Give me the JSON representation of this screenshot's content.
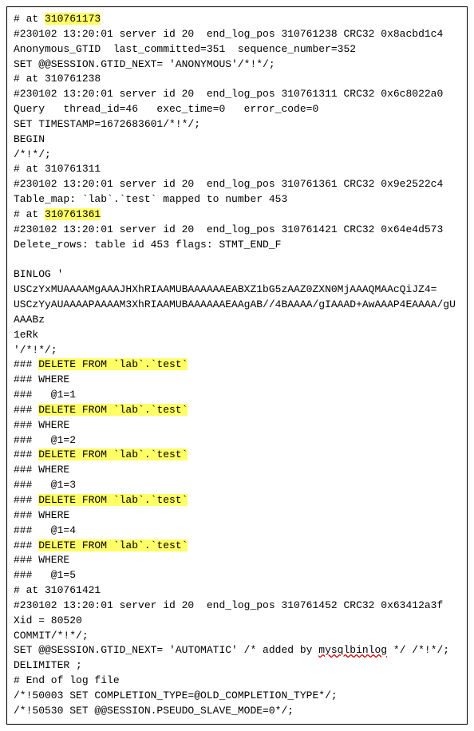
{
  "lines": [
    {
      "segments": [
        {
          "t": "# at "
        },
        {
          "t": "310761173",
          "hl": true
        }
      ]
    },
    {
      "segments": [
        {
          "t": "#230102 13:20:01 server id 20  end_log_pos 310761238 CRC32 0x8acbd1c4   Anonymous_GTID  last_committed=351  sequence_number=352"
        }
      ]
    },
    {
      "segments": [
        {
          "t": "SET @@SESSION.GTID_NEXT= 'ANONYMOUS'/*!*/;"
        }
      ]
    },
    {
      "segments": [
        {
          "t": "# at 310761238"
        }
      ]
    },
    {
      "segments": [
        {
          "t": "#230102 13:20:01 server id 20  end_log_pos 310761311 CRC32 0x6c8022a0   Query   thread_id=46   exec_time=0   error_code=0"
        }
      ]
    },
    {
      "segments": [
        {
          "t": "SET TIMESTAMP=1672683601/*!*/;"
        }
      ]
    },
    {
      "segments": [
        {
          "t": "BEGIN"
        }
      ]
    },
    {
      "segments": [
        {
          "t": "/*!*/;"
        }
      ]
    },
    {
      "segments": [
        {
          "t": "# at 310761311"
        }
      ]
    },
    {
      "segments": [
        {
          "t": "#230102 13:20:01 server id 20  end_log_pos 310761361 CRC32 0x9e2522c4   Table_map: `lab`.`test` mapped to number 453"
        }
      ]
    },
    {
      "segments": [
        {
          "t": "# at "
        },
        {
          "t": "310761361",
          "hl": true
        }
      ]
    },
    {
      "segments": [
        {
          "t": "#230102 13:20:01 server id 20  end_log_pos 310761421 CRC32 0x64e4d573   Delete_rows: table id 453 flags: STMT_END_F"
        }
      ]
    },
    {
      "blank": true
    },
    {
      "segments": [
        {
          "t": "BINLOG '"
        }
      ]
    },
    {
      "segments": [
        {
          "t": "USCzYxMUAAAAMgAAAJHXhRIAAMUBAAAAAAEABXZ1bG5zAAZ0ZXN0MjAAAQMAAcQiJZ4="
        },
        {
          "t": ""
        }
      ]
    },
    {
      "segments": [
        {
          "t": "USCzYyAUAAAAPAAAAM3XhRIAAMUBAAAAAAEAAgAB//4BAAAA/gIAAAD+AwAAAP4EAAAA/gUAAABz"
        }
      ]
    },
    {
      "segments": [
        {
          "t": "1eRk"
        }
      ]
    },
    {
      "segments": [
        {
          "t": "'/*!*/;"
        }
      ]
    },
    {
      "segments": [
        {
          "t": "### "
        },
        {
          "t": "DELETE FROM `lab`.`test`",
          "hl": true
        }
      ]
    },
    {
      "segments": [
        {
          "t": "### WHERE"
        }
      ]
    },
    {
      "segments": [
        {
          "t": "###   @1=1"
        }
      ]
    },
    {
      "segments": [
        {
          "t": "### "
        },
        {
          "t": "DELETE FROM `lab`.`test`",
          "hl": true
        }
      ]
    },
    {
      "segments": [
        {
          "t": "### WHERE"
        }
      ]
    },
    {
      "segments": [
        {
          "t": "###   @1=2"
        }
      ]
    },
    {
      "segments": [
        {
          "t": "### "
        },
        {
          "t": "DELETE FROM `lab`.`test`",
          "hl": true
        }
      ]
    },
    {
      "segments": [
        {
          "t": "### WHERE"
        }
      ]
    },
    {
      "segments": [
        {
          "t": "###   @1=3"
        }
      ]
    },
    {
      "segments": [
        {
          "t": "### "
        },
        {
          "t": "DELETE FROM `lab`.`test`",
          "hl": true
        }
      ]
    },
    {
      "segments": [
        {
          "t": "### WHERE"
        }
      ]
    },
    {
      "segments": [
        {
          "t": "###   @1=4"
        }
      ]
    },
    {
      "segments": [
        {
          "t": "### "
        },
        {
          "t": "DELETE FROM `lab`.`test`",
          "hl": true
        }
      ]
    },
    {
      "segments": [
        {
          "t": "### WHERE"
        }
      ]
    },
    {
      "segments": [
        {
          "t": "###   @1=5"
        }
      ]
    },
    {
      "segments": [
        {
          "t": "# at 310761421"
        }
      ]
    },
    {
      "segments": [
        {
          "t": "#230102 13:20:01 server id 20  end_log_pos 310761452 CRC32 0x63412a3f   Xid = 80520"
        }
      ]
    },
    {
      "segments": [
        {
          "t": "COMMIT/*!*/;"
        }
      ]
    },
    {
      "segments": [
        {
          "t": "SET @@SESSION.GTID_NEXT= 'AUTOMATIC' /* added by "
        },
        {
          "t": "mysqlbinlog",
          "ul": true
        },
        {
          "t": " */ /*!*/;"
        }
      ]
    },
    {
      "segments": [
        {
          "t": "DELIMITER ;"
        }
      ]
    },
    {
      "segments": [
        {
          "t": "# End of log file"
        }
      ]
    },
    {
      "segments": [
        {
          "t": "/*!50003 SET COMPLETION_TYPE=@OLD_COMPLETION_TYPE*/;"
        }
      ]
    },
    {
      "segments": [
        {
          "t": "/*!50530 SET @@SESSION.PSEUDO_SLAVE_MODE=0*/;"
        }
      ]
    }
  ]
}
